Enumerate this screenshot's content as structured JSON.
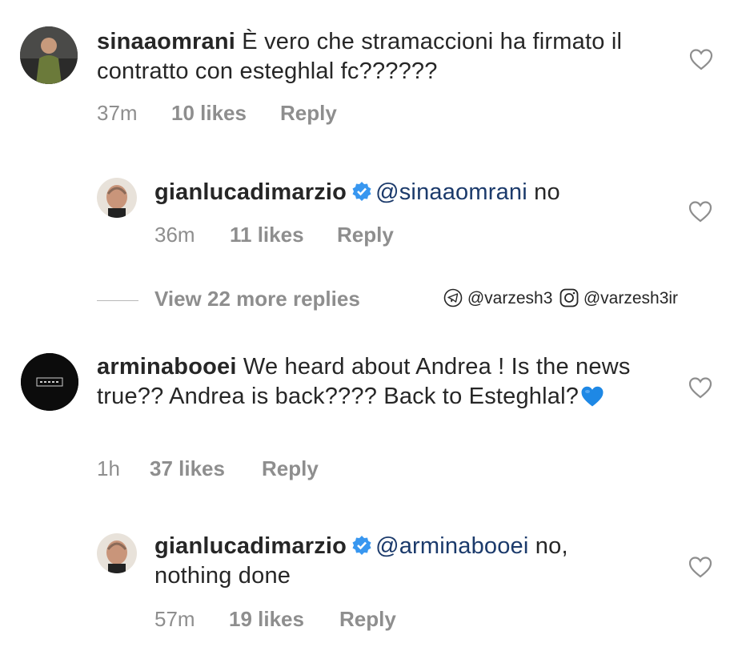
{
  "comments": [
    {
      "username": "sinaaomrani",
      "text": " È vero che stramaccioni ha firmato il contratto con esteghlal fc??????",
      "time": "37m",
      "likes": "10 likes",
      "reply": "Reply"
    },
    {
      "username": "gianlucadimarzio",
      "verified": true,
      "mention": "@sinaaomrani",
      "text": " no",
      "time": "36m",
      "likes": "11 likes",
      "reply": "Reply"
    },
    {
      "username": "arminabooei",
      "text": " We heard about Andrea ! Is the news true?? Andrea is back???? Back to Esteghlal?",
      "emoji": "blue-heart",
      "avatar_text": "HALSEY",
      "time": "1h",
      "likes": "37 likes",
      "reply": "Reply"
    },
    {
      "username": "gianlucadimarzio",
      "verified": true,
      "mention": "@arminabooei",
      "text": " no, nothing done",
      "time": "57m",
      "likes": "19 likes",
      "reply": "Reply"
    }
  ],
  "view_more": "View 22 more replies",
  "watermark": {
    "telegram": "@varzesh3",
    "instagram": "@varzesh3ir"
  },
  "colors": {
    "text": "#262626",
    "meta": "#8e8e8e",
    "mention": "#1b3a6b",
    "verified": "#3897f0",
    "heart_emoji": "#1e88e5"
  }
}
